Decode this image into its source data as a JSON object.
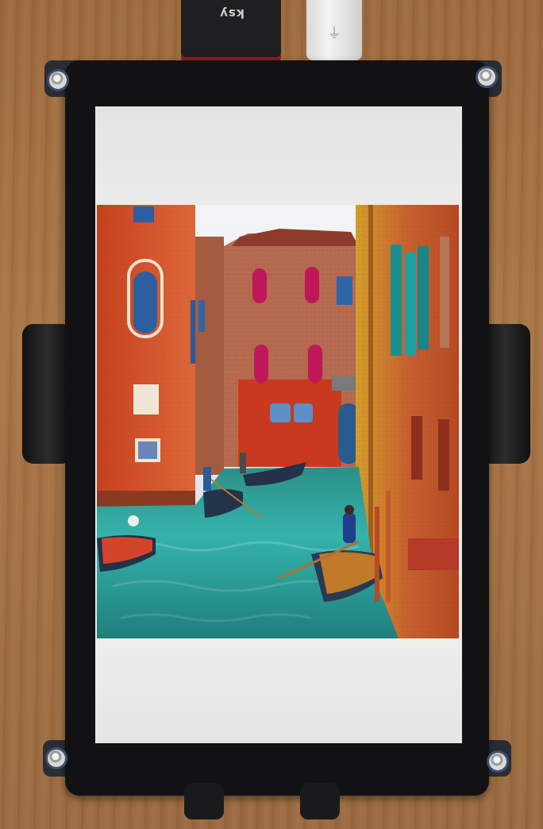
{
  "photo": {
    "sd_card_label": "ksy"
  },
  "colors": {
    "table_wood": "#a87647",
    "bezel": "#121214",
    "screen_background": "#e9e9e9",
    "canal_water": "#2fa6a0",
    "left_building": "#d2552a",
    "center_building": "#b86a4e",
    "shutters_magenta": "#c0175a"
  }
}
